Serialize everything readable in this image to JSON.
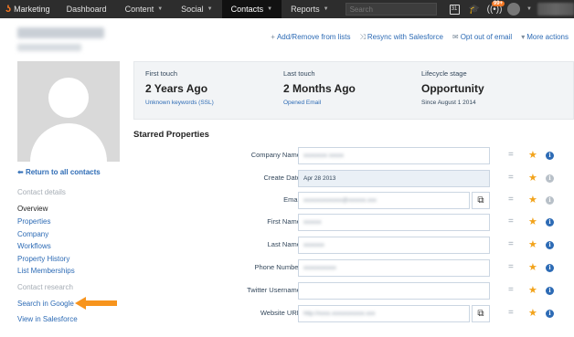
{
  "nav": {
    "brand": "Marketing",
    "items": [
      {
        "label": "Dashboard",
        "caret": false,
        "active": false
      },
      {
        "label": "Content",
        "caret": true,
        "active": false
      },
      {
        "label": "Social",
        "caret": true,
        "active": false
      },
      {
        "label": "Contacts",
        "caret": true,
        "active": true
      },
      {
        "label": "Reports",
        "caret": true,
        "active": false
      }
    ],
    "search_placeholder": "Search",
    "calendar_day": "31",
    "notification_count": "99+"
  },
  "actions": {
    "add_remove": "Add/Remove from lists",
    "resync": "Resync with Salesforce",
    "opt_out": "Opt out of email",
    "more": "More actions"
  },
  "sidebar": {
    "back": "Return to all contacts",
    "contact_details_header": "Contact details",
    "items": [
      "Overview",
      "Properties",
      "Company",
      "Workflows",
      "Property History",
      "List Memberships"
    ],
    "contact_research_header": "Contact research",
    "research_items": [
      "Search in Google",
      "View in Salesforce"
    ]
  },
  "summary": {
    "first_touch": {
      "label": "First touch",
      "value": "2 Years Ago",
      "detail": "Unknown keywords (SSL)"
    },
    "last_touch": {
      "label": "Last touch",
      "value": "2 Months Ago",
      "detail": "Opened Email"
    },
    "lifecycle": {
      "label": "Lifecycle stage",
      "value": "Opportunity",
      "detail": "Since August 1 2014"
    }
  },
  "starred_title": "Starred Properties",
  "properties": [
    {
      "label": "Company Name:",
      "value": "",
      "readonly": false,
      "external": false,
      "info": "on"
    },
    {
      "label": "Create Date:",
      "value": "Apr 28 2013",
      "readonly": true,
      "external": false,
      "info": "off"
    },
    {
      "label": "Email:",
      "value": "",
      "readonly": false,
      "external": true,
      "info": "off"
    },
    {
      "label": "First Name:",
      "value": "",
      "readonly": false,
      "external": false,
      "info": "on"
    },
    {
      "label": "Last Name:",
      "value": "",
      "readonly": false,
      "external": false,
      "info": "on"
    },
    {
      "label": "Phone Number:",
      "value": "",
      "readonly": false,
      "external": false,
      "info": "on"
    },
    {
      "label": "Twitter Username:",
      "value": "",
      "readonly": false,
      "external": false,
      "info": "on"
    },
    {
      "label": "Website URL:",
      "value": "",
      "readonly": false,
      "external": true,
      "info": "on"
    }
  ],
  "colors": {
    "accent": "#f57722",
    "link": "#2d6bb5",
    "nav_bg": "#2d2d2d",
    "star": "#f2a31b"
  }
}
